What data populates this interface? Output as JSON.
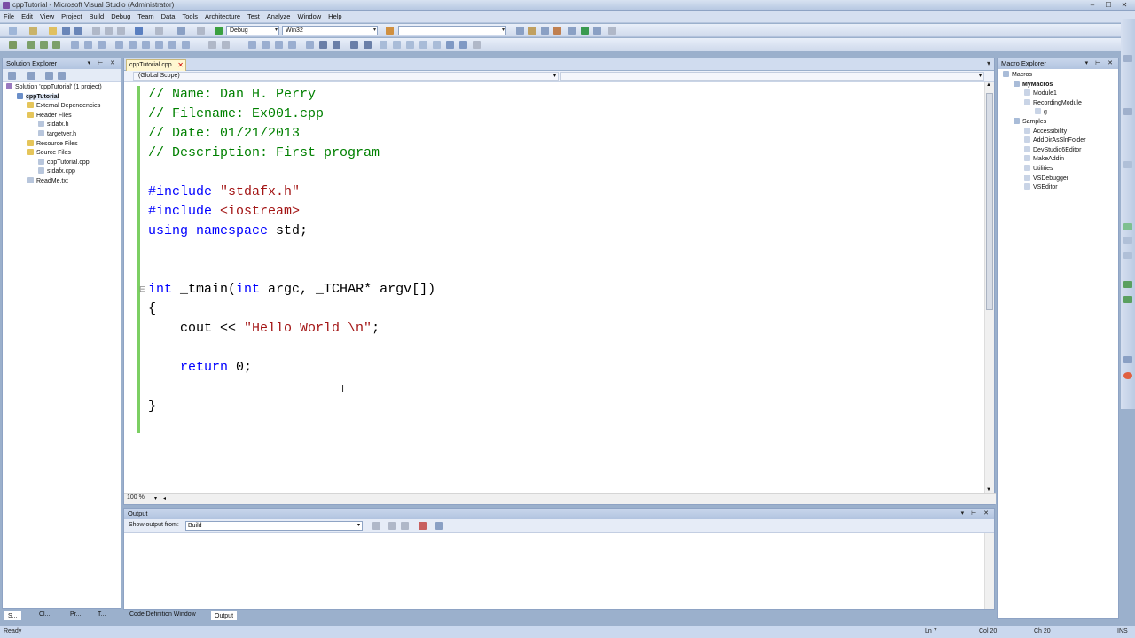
{
  "window": {
    "title": "cppTutorial - Microsoft Visual Studio (Administrator)",
    "min": "‒",
    "max": "☐",
    "close": "✕"
  },
  "menu": [
    "File",
    "Edit",
    "View",
    "Project",
    "Build",
    "Debug",
    "Team",
    "Data",
    "Tools",
    "Architecture",
    "Test",
    "Analyze",
    "Window",
    "Help"
  ],
  "toolbar": {
    "config": "Debug",
    "platform": "Win32"
  },
  "solution_explorer": {
    "title": "Solution Explorer",
    "items": [
      {
        "label": "Solution 'cppTutorial' (1 project)",
        "indent": 0,
        "icon": "solution-icon"
      },
      {
        "label": "cppTutorial",
        "indent": 1,
        "icon": "project-icon"
      },
      {
        "label": "External Dependencies",
        "indent": 2,
        "icon": "folder-icon"
      },
      {
        "label": "Header Files",
        "indent": 2,
        "icon": "folder-icon"
      },
      {
        "label": "stdafx.h",
        "indent": 3,
        "icon": "file-icon"
      },
      {
        "label": "targetver.h",
        "indent": 3,
        "icon": "file-icon"
      },
      {
        "label": "Resource Files",
        "indent": 2,
        "icon": "folder-icon"
      },
      {
        "label": "Source Files",
        "indent": 2,
        "icon": "folder-icon"
      },
      {
        "label": "cppTutorial.cpp",
        "indent": 3,
        "icon": "file-icon"
      },
      {
        "label": "stdafx.cpp",
        "indent": 3,
        "icon": "file-icon"
      },
      {
        "label": "ReadMe.txt",
        "indent": 2,
        "icon": "file-icon"
      }
    ]
  },
  "editor": {
    "tab": "cppTutorial.cpp",
    "scope": "(Global Scope)",
    "zoom": "100 %",
    "lines": {
      "l1": "// Name: Dan H. Perry",
      "l2": "// Filename: Ex001.cpp",
      "l3": "// Date: 01/21/2013",
      "l4": "// Description: First program",
      "inc1_kw": "#include",
      "inc1_str": "\"stdafx.h\"",
      "inc2_kw": "#include",
      "inc2_str": "<iostream>",
      "using_kw": "using namespace",
      "using_rest": " std;",
      "main_kw1": "int",
      "main_mid": " _tmain(",
      "main_kw2": "int",
      "main_rest": " argc, _TCHAR* argv[])",
      "brace_open": "{",
      "cout_a": "    cout << ",
      "cout_str": "\"Hello World \\n\"",
      "cout_b": ";",
      "ret_kw": "    return",
      "ret_rest": " 0;",
      "brace_close": "}"
    }
  },
  "macro_explorer": {
    "title": "Macro Explorer",
    "items": [
      {
        "label": "Macros",
        "indent": 0
      },
      {
        "label": "MyMacros",
        "indent": 1,
        "bold": true
      },
      {
        "label": "Module1",
        "indent": 2
      },
      {
        "label": "RecordingModule",
        "indent": 2
      },
      {
        "label": "g",
        "indent": 3
      },
      {
        "label": "Samples",
        "indent": 1
      },
      {
        "label": "Accessibility",
        "indent": 2
      },
      {
        "label": "AddDirAsSlnFolder",
        "indent": 2
      },
      {
        "label": "DevStudio6Editor",
        "indent": 2
      },
      {
        "label": "MakeAddin",
        "indent": 2
      },
      {
        "label": "Utilities",
        "indent": 2
      },
      {
        "label": "VSDebugger",
        "indent": 2
      },
      {
        "label": "VSEditor",
        "indent": 2
      }
    ]
  },
  "output": {
    "title": "Output",
    "show_label": "Show output from:",
    "source": "Build"
  },
  "bottom_tabs": {
    "s": "S...",
    "cl": "Cl...",
    "pr": "Pr...",
    "t": "T...",
    "code_def": "Code Definition Window",
    "output": "Output"
  },
  "status": {
    "ready": "Ready",
    "ln": "Ln 7",
    "col": "Col 20",
    "ch": "Ch 20",
    "ins": "INS"
  },
  "colors": {
    "comment": "#008000",
    "keyword": "#0000ff",
    "string": "#a31515",
    "change_margin": "#7ccf63"
  }
}
